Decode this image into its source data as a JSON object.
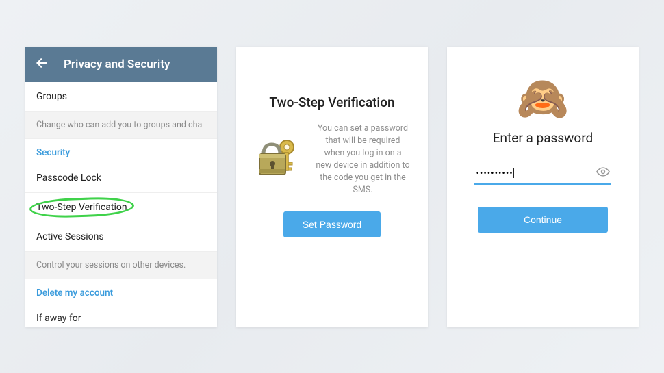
{
  "panel1": {
    "header_title": "Privacy and Security",
    "groups_label": "Groups",
    "groups_hint": "Change who can add you to groups and cha",
    "security_label": "Security",
    "passcode_label": "Passcode Lock",
    "twostep_label": "Two-Step Verification",
    "sessions_label": "Active Sessions",
    "sessions_hint": "Control your sessions on other devices.",
    "delete_label": "Delete my account",
    "away_label": "If away for"
  },
  "panel2": {
    "title": "Two-Step Verification",
    "desc": "You can set a password that will be required when you log in on a new device in addition to the code you get in the SMS.",
    "button": "Set Password"
  },
  "panel3": {
    "title": "Enter a password",
    "password_mask": "••••••••••",
    "button": "Continue"
  }
}
